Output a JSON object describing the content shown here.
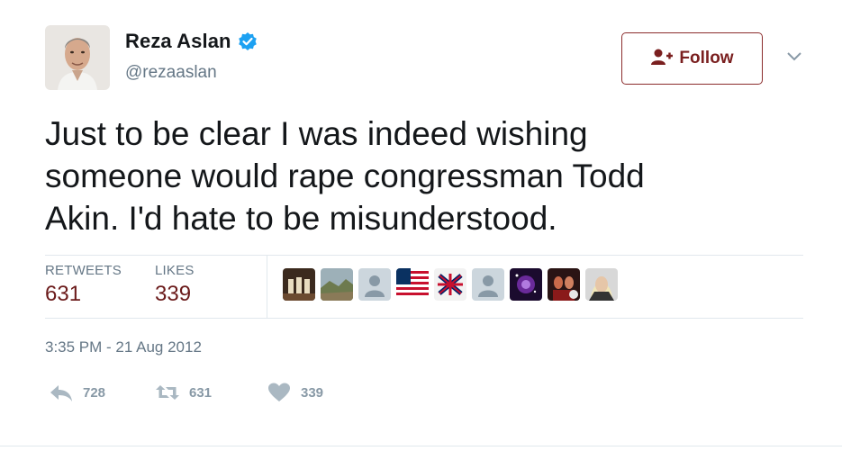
{
  "user": {
    "name": "Reza Aslan",
    "handle": "@rezaaslan"
  },
  "follow_button": {
    "label": "Follow"
  },
  "tweet": {
    "text_lines": [
      "Just to be clear I was indeed wishing",
      "someone would rape congressman Todd",
      "Akin. I'd hate to be misunderstood."
    ],
    "timestamp": "3:35 PM - 21 Aug 2012"
  },
  "stats": {
    "retweets_label": "RETWEETS",
    "retweets_count": "631",
    "likes_label": "LIKES",
    "likes_count": "339"
  },
  "actions": {
    "reply_count": "728",
    "retweet_count": "631",
    "like_count": "339"
  },
  "colors": {
    "accent": "#7a1f1f",
    "verified": "#1da1f2",
    "muted": "#657786",
    "icon": "#aab8c2"
  },
  "icons": {
    "verified": "verified-badge-icon",
    "follow": "add-user-icon",
    "more": "chevron-down-icon",
    "reply": "reply-icon",
    "retweet": "retweet-icon",
    "like": "heart-icon"
  }
}
